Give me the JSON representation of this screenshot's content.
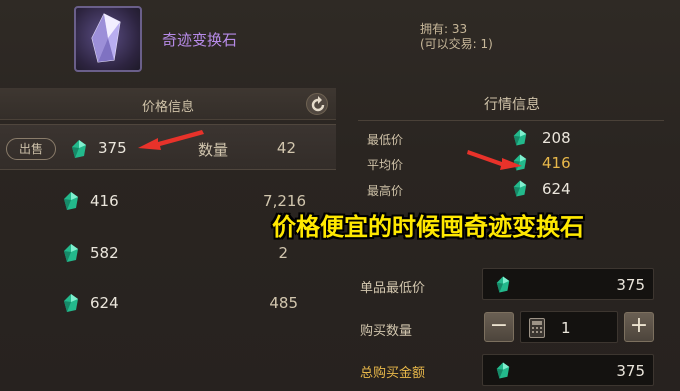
{
  "item": {
    "name": "奇迹变换石",
    "owned_line1": "拥有: 33",
    "owned_line2": "(可以交易: 1)",
    "icon": "crystal-icon"
  },
  "price_info": {
    "title": "价格信息",
    "sell_label": "出售",
    "qty_label": "数量",
    "listings": [
      {
        "price": "375",
        "qty": "42",
        "selected": true
      },
      {
        "price": "416",
        "qty": "7,216"
      },
      {
        "price": "582",
        "qty": "2"
      },
      {
        "price": "624",
        "qty": "485"
      }
    ]
  },
  "market_info": {
    "title": "行情信息",
    "stats": [
      {
        "label": "最低价",
        "value": "208",
        "color": "#ebe6dc"
      },
      {
        "label": "平均价",
        "value": "416",
        "color": "#e8b84a"
      },
      {
        "label": "最高价",
        "value": "624",
        "color": "#ebe6dc"
      }
    ]
  },
  "purchase": {
    "unit_min_label": "单品最低价",
    "unit_min_value": "375",
    "qty_label": "购买数量",
    "qty_value": "1",
    "minus": "−",
    "plus": "+",
    "total_label": "总购买金额",
    "total_value": "375"
  },
  "caption": "价格便宜的时候囤奇迹变换石",
  "colors": {
    "gem": "#2fd0a0",
    "caption": "#ffe800",
    "arrow": "#e8322a",
    "name": "#b78be8"
  }
}
